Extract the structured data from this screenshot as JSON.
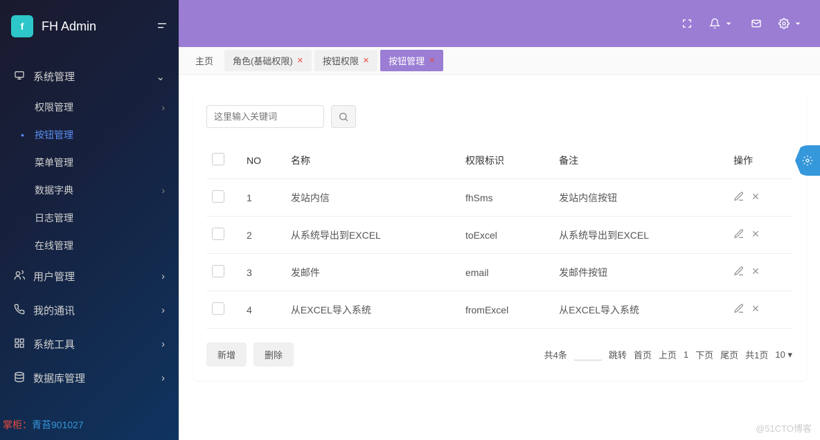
{
  "brand": {
    "logo": "f",
    "title": "FH Admin"
  },
  "sidebar": {
    "groups": [
      {
        "icon": "monitor",
        "label": "系统管理",
        "expanded": true,
        "items": [
          {
            "label": "权限管理",
            "hasChildren": true
          },
          {
            "label": "按钮管理",
            "active": true
          },
          {
            "label": "菜单管理"
          },
          {
            "label": "数据字典",
            "hasChildren": true
          },
          {
            "label": "日志管理"
          },
          {
            "label": "在线管理"
          }
        ]
      },
      {
        "icon": "users",
        "label": "用户管理"
      },
      {
        "icon": "phone",
        "label": "我的通讯"
      },
      {
        "icon": "grid",
        "label": "系统工具"
      },
      {
        "icon": "database",
        "label": "数据库管理"
      }
    ],
    "footer": {
      "label": "掌柜：",
      "value": "青苔901027"
    }
  },
  "topbar": {
    "icons": [
      "fullscreen",
      "bell",
      "mail",
      "gear"
    ]
  },
  "tabs": [
    {
      "label": "主页",
      "closable": false
    },
    {
      "label": "角色(基础权限)",
      "closable": true
    },
    {
      "label": "按钮权限",
      "closable": true
    },
    {
      "label": "按钮管理",
      "closable": true,
      "active": true
    }
  ],
  "search": {
    "placeholder": "这里输入关键词"
  },
  "table": {
    "columns": [
      "",
      "NO",
      "名称",
      "权限标识",
      "备注",
      "操作"
    ],
    "rows": [
      {
        "no": "1",
        "name": "发站内信",
        "perm": "fhSms",
        "note": "发站内信按钮"
      },
      {
        "no": "2",
        "name": "从系统导出到EXCEL",
        "perm": "toExcel",
        "note": "从系统导出到EXCEL"
      },
      {
        "no": "3",
        "name": "发邮件",
        "perm": "email",
        "note": "发邮件按钮"
      },
      {
        "no": "4",
        "name": "从EXCEL导入系统",
        "perm": "fromExcel",
        "note": "从EXCEL导入系统"
      }
    ]
  },
  "buttons": {
    "add": "新增",
    "del": "删除"
  },
  "pager": {
    "total": "共4条",
    "jump": "跳转",
    "first": "首页",
    "prev": "上页",
    "current": "1",
    "next": "下页",
    "last": "尾页",
    "pages": "共1页",
    "size": "10"
  },
  "watermark": "@51CTO博客"
}
